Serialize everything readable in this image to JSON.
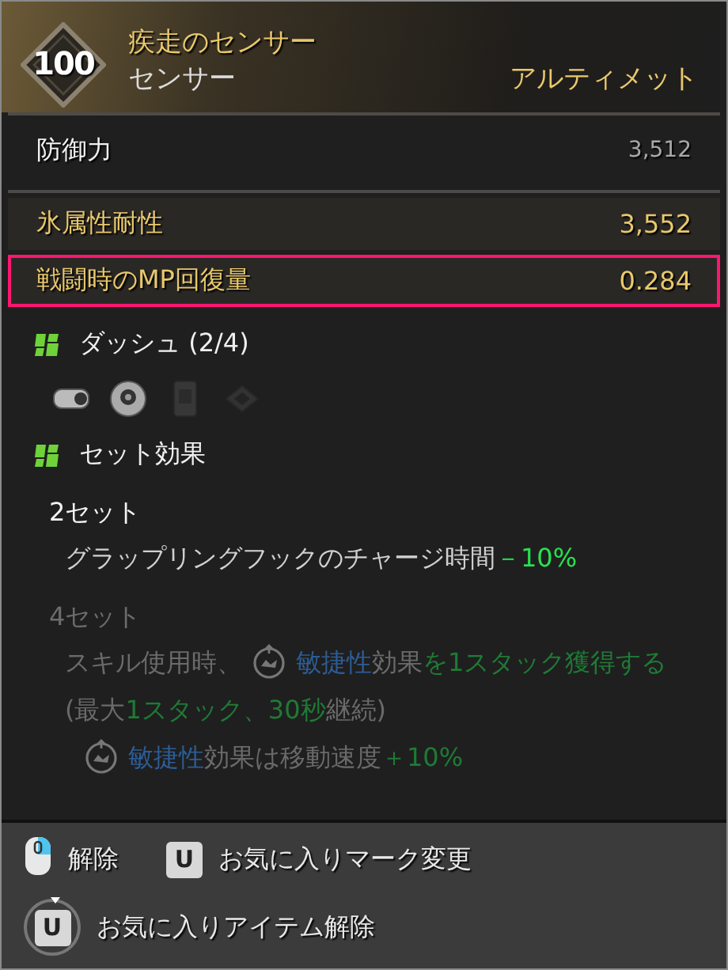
{
  "header": {
    "level": "100",
    "name": "疾走のセンサー",
    "type": "センサー",
    "grade": "アルティメット"
  },
  "stats": [
    {
      "label": "防御力",
      "value": "3,512",
      "kind": "base",
      "selected": false
    },
    {
      "label": "氷属性耐性",
      "value": "3,552",
      "kind": "bonus",
      "selected": false
    },
    {
      "label": "戦闘時のMP回復量",
      "value": "0.284",
      "kind": "bonus",
      "selected": true
    }
  ],
  "set": {
    "title": "ダッシュ (2/4)",
    "pieces": [
      {
        "kind": "cylinder",
        "owned": true
      },
      {
        "kind": "ring",
        "owned": true
      },
      {
        "kind": "box",
        "owned": false
      },
      {
        "kind": "plate",
        "owned": false
      }
    ]
  },
  "set_effect": {
    "title": "セット効果",
    "tiers": [
      {
        "label": "2セット",
        "active": true,
        "lines": [
          [
            {
              "kind": "plain",
              "text": "グラップリングフックのチャージ時間"
            },
            {
              "kind": "up",
              "text": "－10%"
            }
          ]
        ]
      },
      {
        "label": "4セット",
        "active": false,
        "lines": [
          [
            {
              "kind": "plain",
              "text": "スキル使用時、"
            },
            {
              "kind": "icon"
            },
            {
              "kind": "stat",
              "text": "敏捷性"
            },
            {
              "kind": "plain",
              "text": "効果"
            },
            {
              "kind": "up",
              "text": "を1スタック獲得する"
            },
            {
              "kind": "plain",
              "text": "(最大"
            },
            {
              "kind": "up",
              "text": "1スタック、30秒"
            },
            {
              "kind": "plain",
              "text": "継続)"
            }
          ],
          [
            {
              "kind": "icon"
            },
            {
              "kind": "stat",
              "text": "敏捷性"
            },
            {
              "kind": "plain",
              "text": "効果は移動速度"
            },
            {
              "kind": "up",
              "text": "＋10%"
            }
          ]
        ]
      }
    ]
  },
  "hints": [
    [
      {
        "kind": "mouse",
        "label": "解除"
      },
      {
        "kind": "key",
        "key": "U",
        "label": "お気に入りマーク変更"
      }
    ],
    [
      {
        "kind": "hold",
        "key": "U",
        "label": "お気に入りアイテム解除"
      }
    ]
  ]
}
